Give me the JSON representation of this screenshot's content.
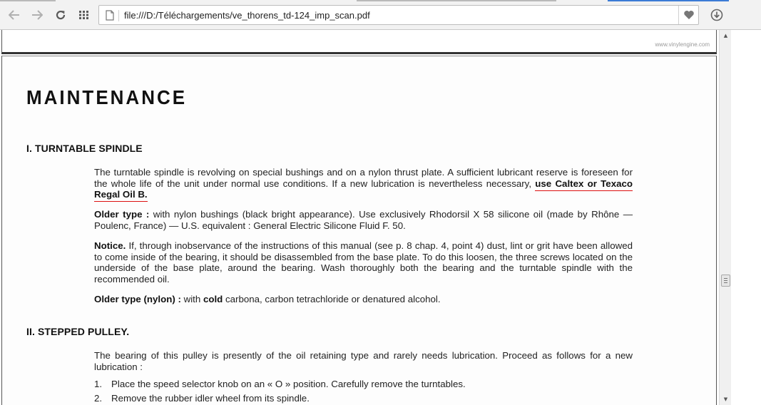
{
  "browser": {
    "url": "file:///D:/Téléchargements/ve_thorens_td-124_imp_scan.pdf",
    "accent_color": "#3c7bd6",
    "icons": [
      "back-arrow-icon",
      "forward-arrow-icon",
      "reload-icon",
      "apps-grid-icon",
      "page-icon",
      "heart-icon",
      "download-icon"
    ]
  },
  "viewer": {
    "watermark": "www.vinylengine.com"
  },
  "document": {
    "title": "MAINTENANCE",
    "section1": {
      "heading": "I.  TURNTABLE  SPINDLE",
      "p1_text": "The turntable spindle is revolving on special bushings and on a nylon thrust plate. A sufficient lubricant reserve is foreseen for the whole life of the unit under normal use conditions. If a new lubrication is nevertheless necessary, ",
      "p1_emphasis": "use Caltex or Texaco Regal Oil B.",
      "p2_label": "Older type :",
      "p2_text": " with nylon bushings (black bright appearance). Use exclusively Rhodorsil X 58 silicone oil (made by Rhône — Poulenc, France) — U.S. equivalent : General Electric Silicone Fluid F. 50.",
      "p3_label": "Notice.",
      "p3_text": " If, through inobservance of the instructions of this manual (see p. 8 chap. 4, point 4) dust, lint or grit have been allowed to come inside of the bearing, it should be disassembled from the base plate. To do this loosen, the three screws located on the underside of the base plate, around the bearing. Wash thoroughly both the bearing and the turntable spindle with the recommended oil.",
      "p4_label": "Older type (nylon) :",
      "p4_mid": " with ",
      "p4_bold": "cold",
      "p4_text": " carbona, carbon tetrachloride or denatured alcohol."
    },
    "section2": {
      "heading": "II.  STEPPED  PULLEY.",
      "p1_text": "The bearing of this pulley is presently of the oil retaining type and rarely needs lubrication. Proceed as follows for a new lubrication :",
      "steps": [
        {
          "num": "1.",
          "text": "Place the speed selector knob on an « O » position. Carefully remove the turntables."
        },
        {
          "num": "2.",
          "text": "Remove the rubber idler wheel from its spindle."
        }
      ]
    }
  }
}
